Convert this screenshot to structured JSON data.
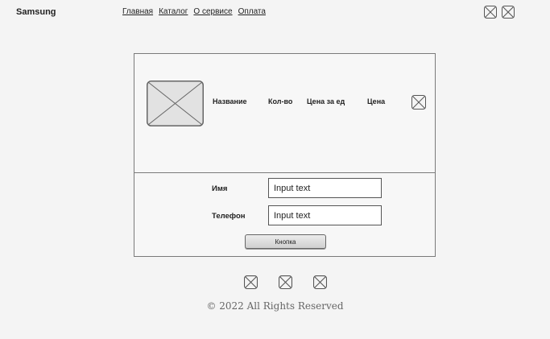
{
  "header": {
    "brand": "Samsung",
    "nav": [
      {
        "label": "Главная"
      },
      {
        "label": "Каталог"
      },
      {
        "label": "О сервисе"
      },
      {
        "label": "Оплата"
      }
    ],
    "icons": [
      "placeholder-icon",
      "placeholder-icon"
    ]
  },
  "cart": {
    "image_icon": "image-placeholder-icon",
    "columns": {
      "name": "Название",
      "qty": "Кол-во",
      "unit_price": "Цена за ед",
      "price": "Цена"
    },
    "remove_icon": "placeholder-icon"
  },
  "form": {
    "name_label": "Имя",
    "name_placeholder": "Input text",
    "phone_label": "Телефон",
    "phone_placeholder": "Input text",
    "submit_label": "Кнопка"
  },
  "footer": {
    "icons": [
      "placeholder-icon",
      "placeholder-icon",
      "placeholder-icon"
    ],
    "copyright": "© 2022 All Rights Reserved"
  },
  "colors": {
    "background": "#f4f4f4",
    "border": "#7a7a7a",
    "button_fill": "#dcdcdc"
  }
}
